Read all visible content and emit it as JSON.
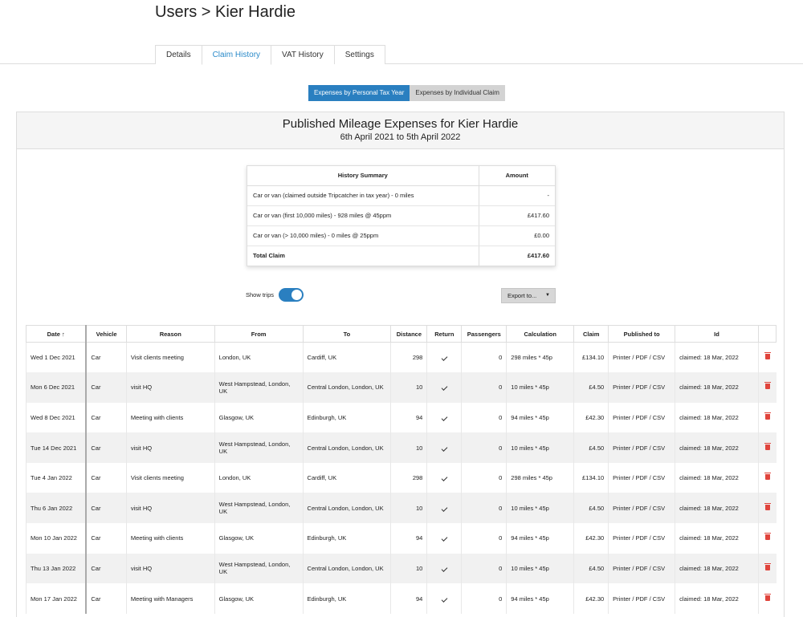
{
  "page": {
    "breadcrumb": "Users > Kier Hardie"
  },
  "tabs": [
    {
      "label": "Details",
      "active": false
    },
    {
      "label": "Claim History",
      "active": true
    },
    {
      "label": "VAT History",
      "active": false
    },
    {
      "label": "Settings",
      "active": false
    }
  ],
  "view_toggle": {
    "by_tax_year": "Expenses by Personal Tax Year",
    "by_claim": "Expenses by Individual Claim"
  },
  "panel": {
    "title": "Published Mileage Expenses for Kier Hardie",
    "subtitle": "6th April 2021 to 5th April 2022"
  },
  "summary": {
    "headers": {
      "label": "History Summary",
      "amount": "Amount"
    },
    "rows": [
      {
        "label": "Car or van (claimed outside Tripcatcher in tax year) - 0 miles",
        "amount": "-"
      },
      {
        "label": "Car or van (first 10,000 miles) - 928 miles @ 45ppm",
        "amount": "£417.60"
      },
      {
        "label": "Car or van (> 10,000 miles) - 0 miles @ 25ppm",
        "amount": "£0.00"
      },
      {
        "label": "Total Claim",
        "amount": "£417.60"
      }
    ]
  },
  "controls": {
    "show_trips_label": "Show trips",
    "show_trips_on": true,
    "export_label": "Export to..."
  },
  "table": {
    "headers": {
      "date": "Date ↑",
      "vehicle": "Vehicle",
      "reason": "Reason",
      "from": "From",
      "to": "To",
      "distance": "Distance",
      "return": "Return",
      "passengers": "Passengers",
      "calculation": "Calculation",
      "claim": "Claim",
      "published": "Published to",
      "id": "Id"
    },
    "rows": [
      {
        "date": "Wed 1 Dec 2021",
        "vehicle": "Car",
        "reason": "Visit clients meeting",
        "from": "London, UK",
        "to": "Cardiff, UK",
        "distance": "298",
        "passengers": "0",
        "calculation": "298 miles * 45p",
        "claim": "£134.10",
        "published": "Printer / PDF / CSV",
        "id": "claimed: 18 Mar, 2022"
      },
      {
        "date": "Mon 6 Dec 2021",
        "vehicle": "Car",
        "reason": "visit HQ",
        "from": "West Hampstead, London, UK",
        "to": "Central London, London, UK",
        "distance": "10",
        "passengers": "0",
        "calculation": "10 miles * 45p",
        "claim": "£4.50",
        "published": "Printer / PDF / CSV",
        "id": "claimed: 18 Mar, 2022"
      },
      {
        "date": "Wed 8 Dec 2021",
        "vehicle": "Car",
        "reason": "Meeting with clients",
        "from": "Glasgow, UK",
        "to": "Edinburgh, UK",
        "distance": "94",
        "passengers": "0",
        "calculation": "94 miles * 45p",
        "claim": "£42.30",
        "published": "Printer / PDF / CSV",
        "id": "claimed: 18 Mar, 2022"
      },
      {
        "date": "Tue 14 Dec 2021",
        "vehicle": "Car",
        "reason": "visit HQ",
        "from": "West Hampstead, London, UK",
        "to": "Central London, London, UK",
        "distance": "10",
        "passengers": "0",
        "calculation": "10 miles * 45p",
        "claim": "£4.50",
        "published": "Printer / PDF / CSV",
        "id": "claimed: 18 Mar, 2022"
      },
      {
        "date": "Tue 4 Jan 2022",
        "vehicle": "Car",
        "reason": "Visit clients meeting",
        "from": "London, UK",
        "to": "Cardiff, UK",
        "distance": "298",
        "passengers": "0",
        "calculation": "298 miles * 45p",
        "claim": "£134.10",
        "published": "Printer / PDF / CSV",
        "id": "claimed: 18 Mar, 2022"
      },
      {
        "date": "Thu 6 Jan 2022",
        "vehicle": "Car",
        "reason": "visit HQ",
        "from": "West Hampstead, London, UK",
        "to": "Central London, London, UK",
        "distance": "10",
        "passengers": "0",
        "calculation": "10 miles * 45p",
        "claim": "£4.50",
        "published": "Printer / PDF / CSV",
        "id": "claimed: 18 Mar, 2022"
      },
      {
        "date": "Mon 10 Jan 2022",
        "vehicle": "Car",
        "reason": "Meeting with clients",
        "from": "Glasgow, UK",
        "to": "Edinburgh, UK",
        "distance": "94",
        "passengers": "0",
        "calculation": "94 miles * 45p",
        "claim": "£42.30",
        "published": "Printer / PDF / CSV",
        "id": "claimed: 18 Mar, 2022"
      },
      {
        "date": "Thu 13 Jan 2022",
        "vehicle": "Car",
        "reason": "visit HQ",
        "from": "West Hampstead, London, UK",
        "to": "Central London, London, UK",
        "distance": "10",
        "passengers": "0",
        "calculation": "10 miles * 45p",
        "claim": "£4.50",
        "published": "Printer / PDF / CSV",
        "id": "claimed: 18 Mar, 2022"
      },
      {
        "date": "Mon 17 Jan 2022",
        "vehicle": "Car",
        "reason": "Meeting with Managers",
        "from": "Glasgow, UK",
        "to": "Edinburgh, UK",
        "distance": "94",
        "passengers": "0",
        "calculation": "94 miles * 45p",
        "claim": "£42.30",
        "published": "Printer / PDF / CSV",
        "id": "claimed: 18 Mar, 2022"
      }
    ]
  },
  "icons": {
    "return": "check-icon",
    "delete": "trash-icon",
    "sort": "sort-asc-icon",
    "export": "caret-down-icon"
  },
  "colors": {
    "accent": "#2a7fc0",
    "tab_active": "#2a8ac9",
    "delete": "#e0443c",
    "row_alt": "#f1f1f1"
  }
}
